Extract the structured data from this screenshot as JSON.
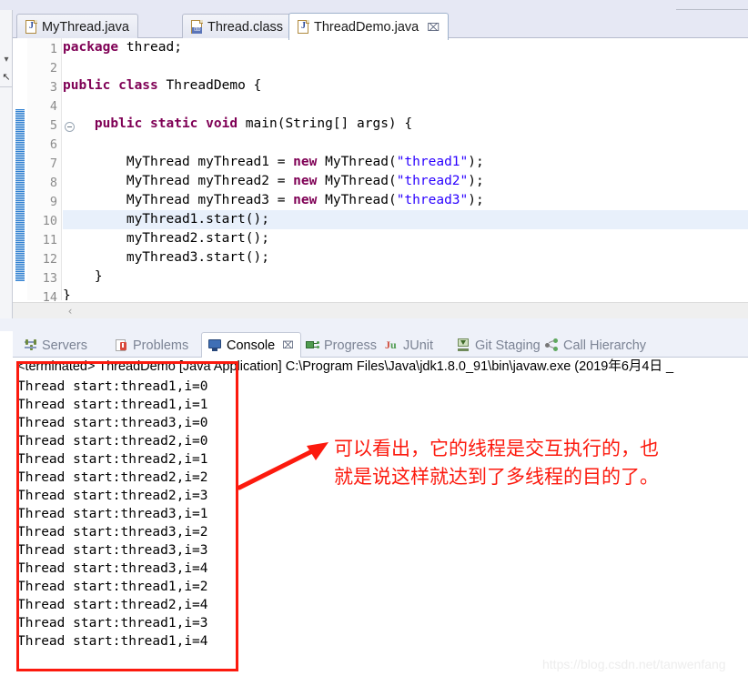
{
  "editor": {
    "tabs": [
      {
        "label": "MyThread.java",
        "icon": "java-file-icon",
        "active": false,
        "closable": false
      },
      {
        "label": "Thread.class",
        "icon": "class-file-icon",
        "active": false,
        "closable": false
      },
      {
        "label": "ThreadDemo.java",
        "icon": "java-file-icon",
        "active": true,
        "closable": true,
        "close_label": "⌧"
      }
    ],
    "line_numbers": [
      "1",
      "2",
      "3",
      "4",
      "5",
      "6",
      "7",
      "8",
      "9",
      "10",
      "11",
      "12",
      "13",
      "14"
    ],
    "highlighted_line": 10,
    "fold_marker_line": 5,
    "code_lines": [
      {
        "n": 1,
        "html": "<span class=\"kw\">package</span> thread;"
      },
      {
        "n": 2,
        "html": ""
      },
      {
        "n": 3,
        "html": "<span class=\"kw\">public class</span> ThreadDemo {"
      },
      {
        "n": 4,
        "html": ""
      },
      {
        "n": 5,
        "html": "    <span class=\"kw\">public static void</span> main(String[] args) {"
      },
      {
        "n": 6,
        "html": ""
      },
      {
        "n": 7,
        "html": "        MyThread myThread1 = <span class=\"kw\">new</span> MyThread(<span class=\"str\">\"thread1\"</span>);"
      },
      {
        "n": 8,
        "html": "        MyThread myThread2 = <span class=\"kw\">new</span> MyThread(<span class=\"str\">\"thread2\"</span>);"
      },
      {
        "n": 9,
        "html": "        MyThread myThread3 = <span class=\"kw\">new</span> MyThread(<span class=\"str\">\"thread3\"</span>);"
      },
      {
        "n": 10,
        "html": "        myThread1.start();"
      },
      {
        "n": 11,
        "html": "        myThread2.start();"
      },
      {
        "n": 12,
        "html": "        myThread3.start();"
      },
      {
        "n": 13,
        "html": "    }"
      },
      {
        "n": 14,
        "html": "}"
      }
    ],
    "scroll_left_arrow": "‹"
  },
  "view_tabs": [
    {
      "label": "Servers",
      "icon": "servers-icon",
      "active": false,
      "closable": false
    },
    {
      "label": "Problems",
      "icon": "problems-icon",
      "active": false,
      "closable": false
    },
    {
      "label": "Console",
      "icon": "console-icon",
      "active": true,
      "closable": true,
      "close_label": "⌧"
    },
    {
      "label": "Progress",
      "icon": "progress-icon",
      "active": false,
      "closable": false
    },
    {
      "label": "JUnit",
      "icon": "junit-icon",
      "active": false,
      "closable": false
    },
    {
      "label": "Git Staging",
      "icon": "git-staging-icon",
      "active": false,
      "closable": false
    },
    {
      "label": "Call Hierarchy",
      "icon": "call-hierarchy-icon",
      "active": false,
      "closable": false
    }
  ],
  "console": {
    "header": "<terminated> ThreadDemo [Java Application] C:\\Program Files\\Java\\jdk1.8.0_91\\bin\\javaw.exe (2019年6月4日 _",
    "lines": [
      "Thread start:thread1,i=0",
      "Thread start:thread1,i=1",
      "Thread start:thread3,i=0",
      "Thread start:thread2,i=0",
      "Thread start:thread2,i=1",
      "Thread start:thread2,i=2",
      "Thread start:thread2,i=3",
      "Thread start:thread3,i=1",
      "Thread start:thread3,i=2",
      "Thread start:thread3,i=3",
      "Thread start:thread3,i=4",
      "Thread start:thread1,i=2",
      "Thread start:thread2,i=4",
      "Thread start:thread1,i=3",
      "Thread start:thread1,i=4"
    ]
  },
  "annotation": {
    "text": "可以看出，它的线程是交互执行的，也\n就是说这样就达到了多线程的目的了。",
    "color": "#fc1a0e"
  },
  "watermark": "https://blog.csdn.net/tanwenfang",
  "left_rail": {
    "arrow_down": "▾",
    "arrow_diag": "↖"
  }
}
